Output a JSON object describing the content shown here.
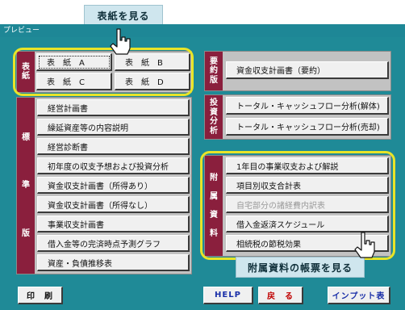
{
  "callouts": {
    "top": "表紙を見る",
    "bottom": "附属資料の帳票を見る"
  },
  "window": {
    "title": "プレビュー"
  },
  "cover": {
    "label_chars": [
      "表",
      "紙"
    ],
    "buttons": [
      "表　紙　A",
      "表　紙　B",
      "表　紙　C",
      "表　紙　D"
    ]
  },
  "standard": {
    "label_chars": [
      "標",
      "準",
      "版"
    ],
    "items": [
      "経営計画書",
      "繰延資産等の内容説明",
      "経営診断書",
      "初年度の収支予想および投資分析",
      "資金収支計画書（所得あり）",
      "資金収支計画書（所得なし）",
      "事業収支計画書",
      "借入金等の完済時点予測グラフ",
      "資産・負債推移表"
    ]
  },
  "summary": {
    "label_chars": [
      "要",
      "約",
      "版"
    ],
    "items": [
      "資金収支計画書（要約）"
    ]
  },
  "investment": {
    "label_chars": [
      "投",
      "資",
      "分",
      "析"
    ],
    "items": [
      "トータル・キャッシュフロー分析(解体)",
      "トータル・キャッシュフロー分析(売却)"
    ]
  },
  "appendix": {
    "label_chars": [
      "附",
      "属",
      "資",
      "料"
    ],
    "items": [
      "1年目の事業収支および解説",
      "項目別収支合計表",
      "自宅部分の諸経費内訳表",
      "借入金返済スケジュール",
      "相続税の節税効果"
    ]
  },
  "footer": {
    "print": "印　刷",
    "help": "HELP",
    "back": "戻　る",
    "input_table": "インプット表"
  },
  "colors": {
    "teal": "#1f8a97",
    "maroon": "#8a1f3d",
    "panel_gray": "#c2c2c2",
    "highlight_yellow": "#e8e428",
    "back_red": "#c00000",
    "input_blue": "#1a2fa8"
  }
}
